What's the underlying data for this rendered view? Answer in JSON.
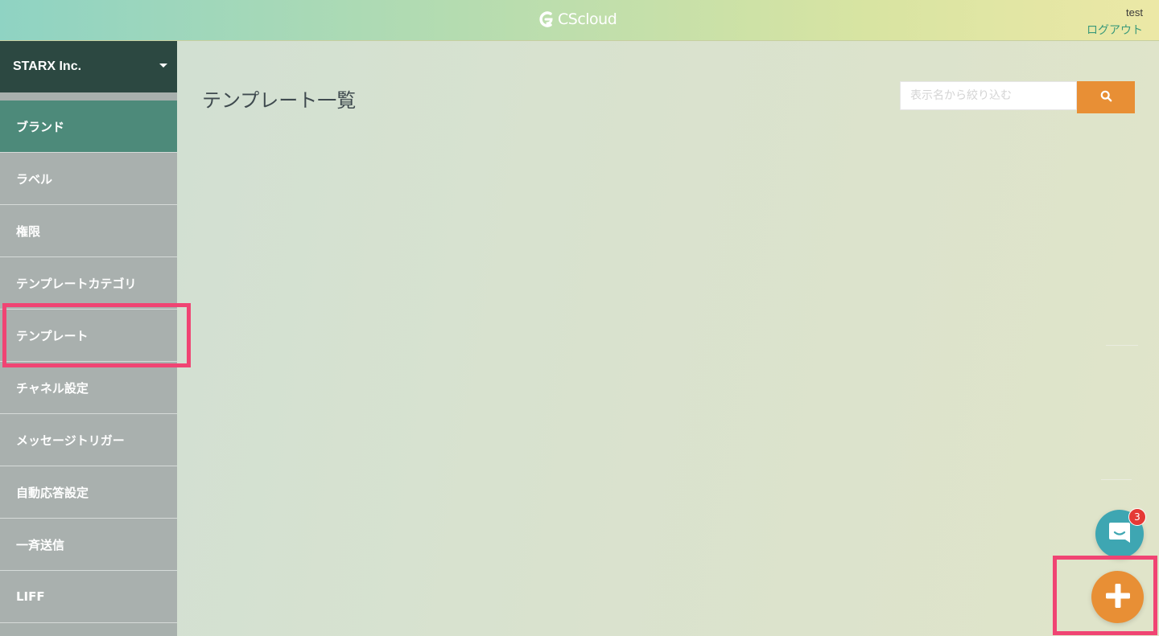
{
  "header": {
    "logo_text": "CScloud",
    "user_name": "test",
    "logout_label": "ログアウト"
  },
  "sidebar": {
    "org_name": "STARX Inc.",
    "items": [
      {
        "label": "ブランド",
        "active": true
      },
      {
        "label": "ラベル",
        "active": false
      },
      {
        "label": "権限",
        "active": false
      },
      {
        "label": "テンプレートカテゴリ",
        "active": false
      },
      {
        "label": "テンプレート",
        "active": false
      },
      {
        "label": "チャネル設定",
        "active": false
      },
      {
        "label": "メッセージトリガー",
        "active": false
      },
      {
        "label": "自動応答設定",
        "active": false
      },
      {
        "label": "一斉送信",
        "active": false
      },
      {
        "label": "LIFF",
        "active": false
      }
    ]
  },
  "main": {
    "title": "テンプレート一覧",
    "search": {
      "placeholder": "表示名から絞り込む",
      "value": ""
    }
  },
  "chat_widget": {
    "badge_count": "3"
  },
  "colors": {
    "accent_orange": "#e88f35",
    "sidebar_dark": "#2c4841",
    "active_item": "#4d8a7a",
    "highlight": "#f04473",
    "chat_teal": "#3ea6b2"
  }
}
